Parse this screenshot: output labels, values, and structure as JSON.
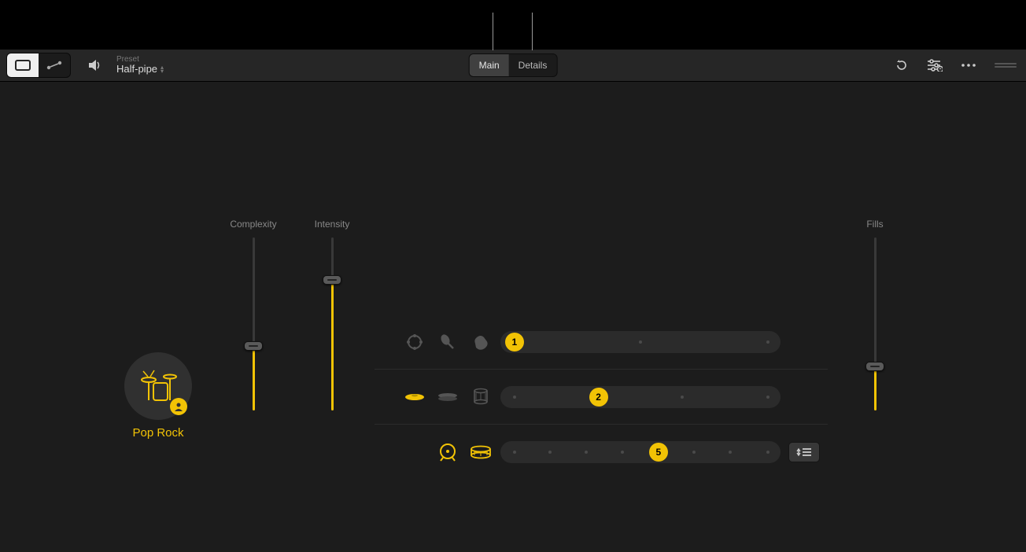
{
  "toolbar": {
    "preset_label": "Preset",
    "preset_name": "Half-pipe"
  },
  "tabs": {
    "main": "Main",
    "details": "Details"
  },
  "drummer": {
    "style": "Pop Rock"
  },
  "sliders": {
    "complexity": {
      "label": "Complexity",
      "value_pct_from_top": 60
    },
    "intensity": {
      "label": "Intensity",
      "value_pct_from_top": 22
    },
    "fills": {
      "label": "Fills",
      "value_pct_from_top": 72
    }
  },
  "patterns": {
    "rows": [
      {
        "value": 1,
        "dots": 3
      },
      {
        "value": 2,
        "dots": 4
      },
      {
        "value": 5,
        "dots": 8
      }
    ]
  },
  "colors": {
    "accent": "#f2c305"
  }
}
